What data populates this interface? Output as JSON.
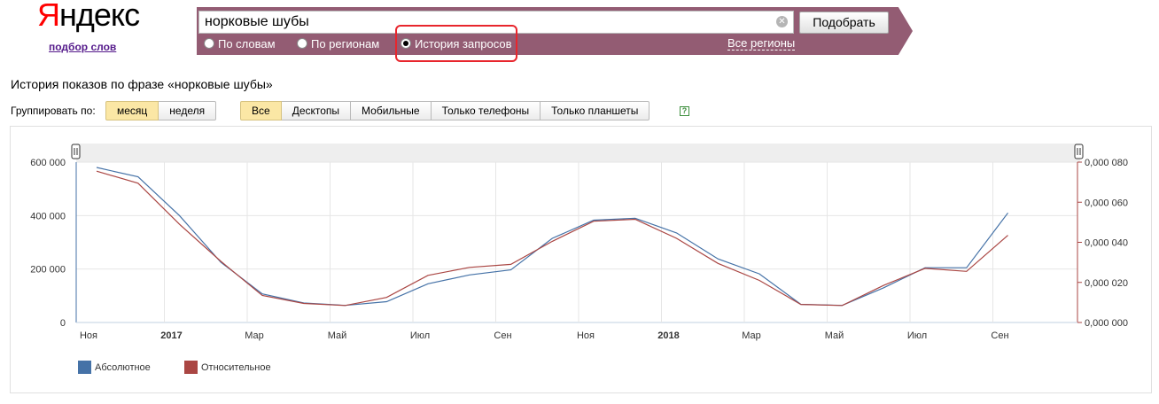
{
  "logo": {
    "first": "Я",
    "rest": "ндекс",
    "sub": "подбор слов"
  },
  "search": {
    "value": "норковые шубы",
    "submit_label": "Подобрать"
  },
  "modes": [
    {
      "label": "По словам",
      "selected": false
    },
    {
      "label": "По регионам",
      "selected": false
    },
    {
      "label": "История запросов",
      "selected": true
    }
  ],
  "regions_link": "Все регионы",
  "page_title": "История показов по фразе «норковые шубы»",
  "grouping": {
    "label": "Группировать по:",
    "options": [
      "месяц",
      "неделя"
    ],
    "active": "месяц"
  },
  "devices": {
    "options": [
      "Все",
      "Десктопы",
      "Мобильные",
      "Только телефоны",
      "Только планшеты"
    ],
    "active": "Все"
  },
  "help": "?",
  "colors": {
    "header": "#935c73",
    "absolute": "#4572a7",
    "relative": "#aa4643",
    "highlight": "#e8262d"
  },
  "chart_data": {
    "type": "line",
    "x_labels": [
      "Ноя",
      "2017",
      "Мар",
      "Май",
      "Июл",
      "Сен",
      "Ноя",
      "2018",
      "Мар",
      "Май",
      "Июл",
      "Сен"
    ],
    "x": [
      "2016-11",
      "2016-12",
      "2017-01",
      "2017-02",
      "2017-03",
      "2017-04",
      "2017-05",
      "2017-06",
      "2017-07",
      "2017-08",
      "2017-09",
      "2017-10",
      "2017-11",
      "2017-12",
      "2018-01",
      "2018-02",
      "2018-03",
      "2018-04",
      "2018-05",
      "2018-06",
      "2018-07",
      "2018-08",
      "2018-09",
      "2018-10"
    ],
    "y_left_ticks": [
      "0",
      "200 000",
      "400 000",
      "600 000"
    ],
    "y_right_ticks": [
      "0,000 000",
      "0,000 020",
      "0,000 040",
      "0,000 060",
      "0,000 080"
    ],
    "y_left_range": [
      0,
      600000
    ],
    "y_right_range": [
      0,
      8e-05
    ],
    "series": [
      {
        "name": "Абсолютное",
        "axis": "left",
        "values": [
          580000,
          545000,
          400000,
          225000,
          107000,
          73000,
          64000,
          78000,
          145000,
          178000,
          197000,
          315000,
          383000,
          390000,
          335000,
          238000,
          182000,
          68000,
          64000,
          130000,
          205000,
          205000,
          410000
        ]
      },
      {
        "name": "Относительное",
        "axis": "right",
        "values": [
          7.55e-05,
          6.95e-05,
          4.9e-05,
          3.05e-05,
          1.35e-05,
          9.5e-06,
          8.5e-06,
          1.25e-05,
          2.35e-05,
          2.75e-05,
          2.9e-05,
          4.05e-05,
          5.05e-05,
          5.15e-05,
          4.2e-05,
          2.95e-05,
          2.1e-05,
          9e-06,
          8.5e-06,
          1.85e-05,
          2.7e-05,
          2.55e-05,
          4.35e-05
        ]
      }
    ],
    "grid": true,
    "legend": "bottom-left"
  }
}
